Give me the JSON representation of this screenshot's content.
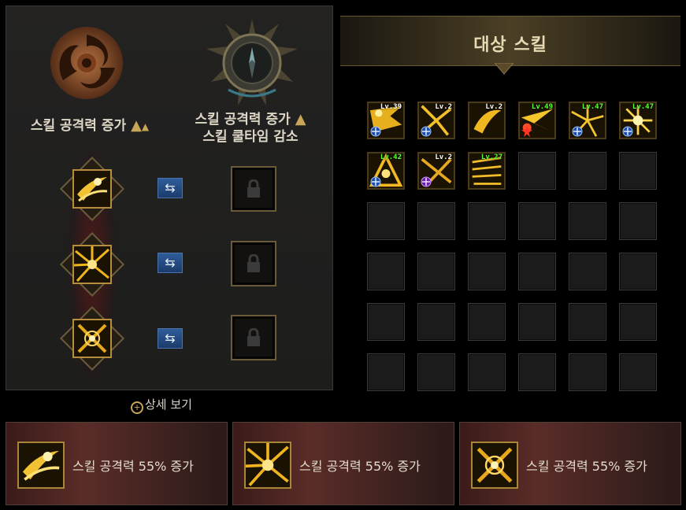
{
  "left_panel": {
    "left_title": "스킬 공격력 증가",
    "right_title_line1": "스킬 공격력 증가",
    "right_title_line2": "스킬 쿨타임 감소",
    "detail_link": "상세 보기"
  },
  "right_panel": {
    "header_title": "대상 스킬",
    "skills": [
      {
        "level": "Lv.39",
        "level_color": "white",
        "badge": "blue-crosshair"
      },
      {
        "level": "Lv.2",
        "level_color": "white",
        "badge": "blue-crosshair"
      },
      {
        "level": "Lv.2",
        "level_color": "white",
        "badge": "none"
      },
      {
        "level": "Lv.49",
        "level_color": "green",
        "badge": "red-star"
      },
      {
        "level": "Lv.47",
        "level_color": "green",
        "badge": "blue-crosshair"
      },
      {
        "level": "Lv.47",
        "level_color": "green",
        "badge": "blue-crosshair"
      },
      {
        "level": "Lv.42",
        "level_color": "green",
        "badge": "blue-crosshair"
      },
      {
        "level": "Lv.2",
        "level_color": "white",
        "badge": "purple-crosshair"
      },
      {
        "level": "Lv.27",
        "level_color": "green",
        "badge": "none"
      }
    ]
  },
  "cards": [
    {
      "text": "스킬 공격력 55% 증가"
    },
    {
      "text": "스킬 공격력 55% 증가"
    },
    {
      "text": "스킬 공격력 55% 증가"
    }
  ],
  "colors": {
    "accent_gold": "#c7a757",
    "swap_blue": "#2e5d9a",
    "card_red": "#5a2c28",
    "level_green": "#5dff3a"
  }
}
